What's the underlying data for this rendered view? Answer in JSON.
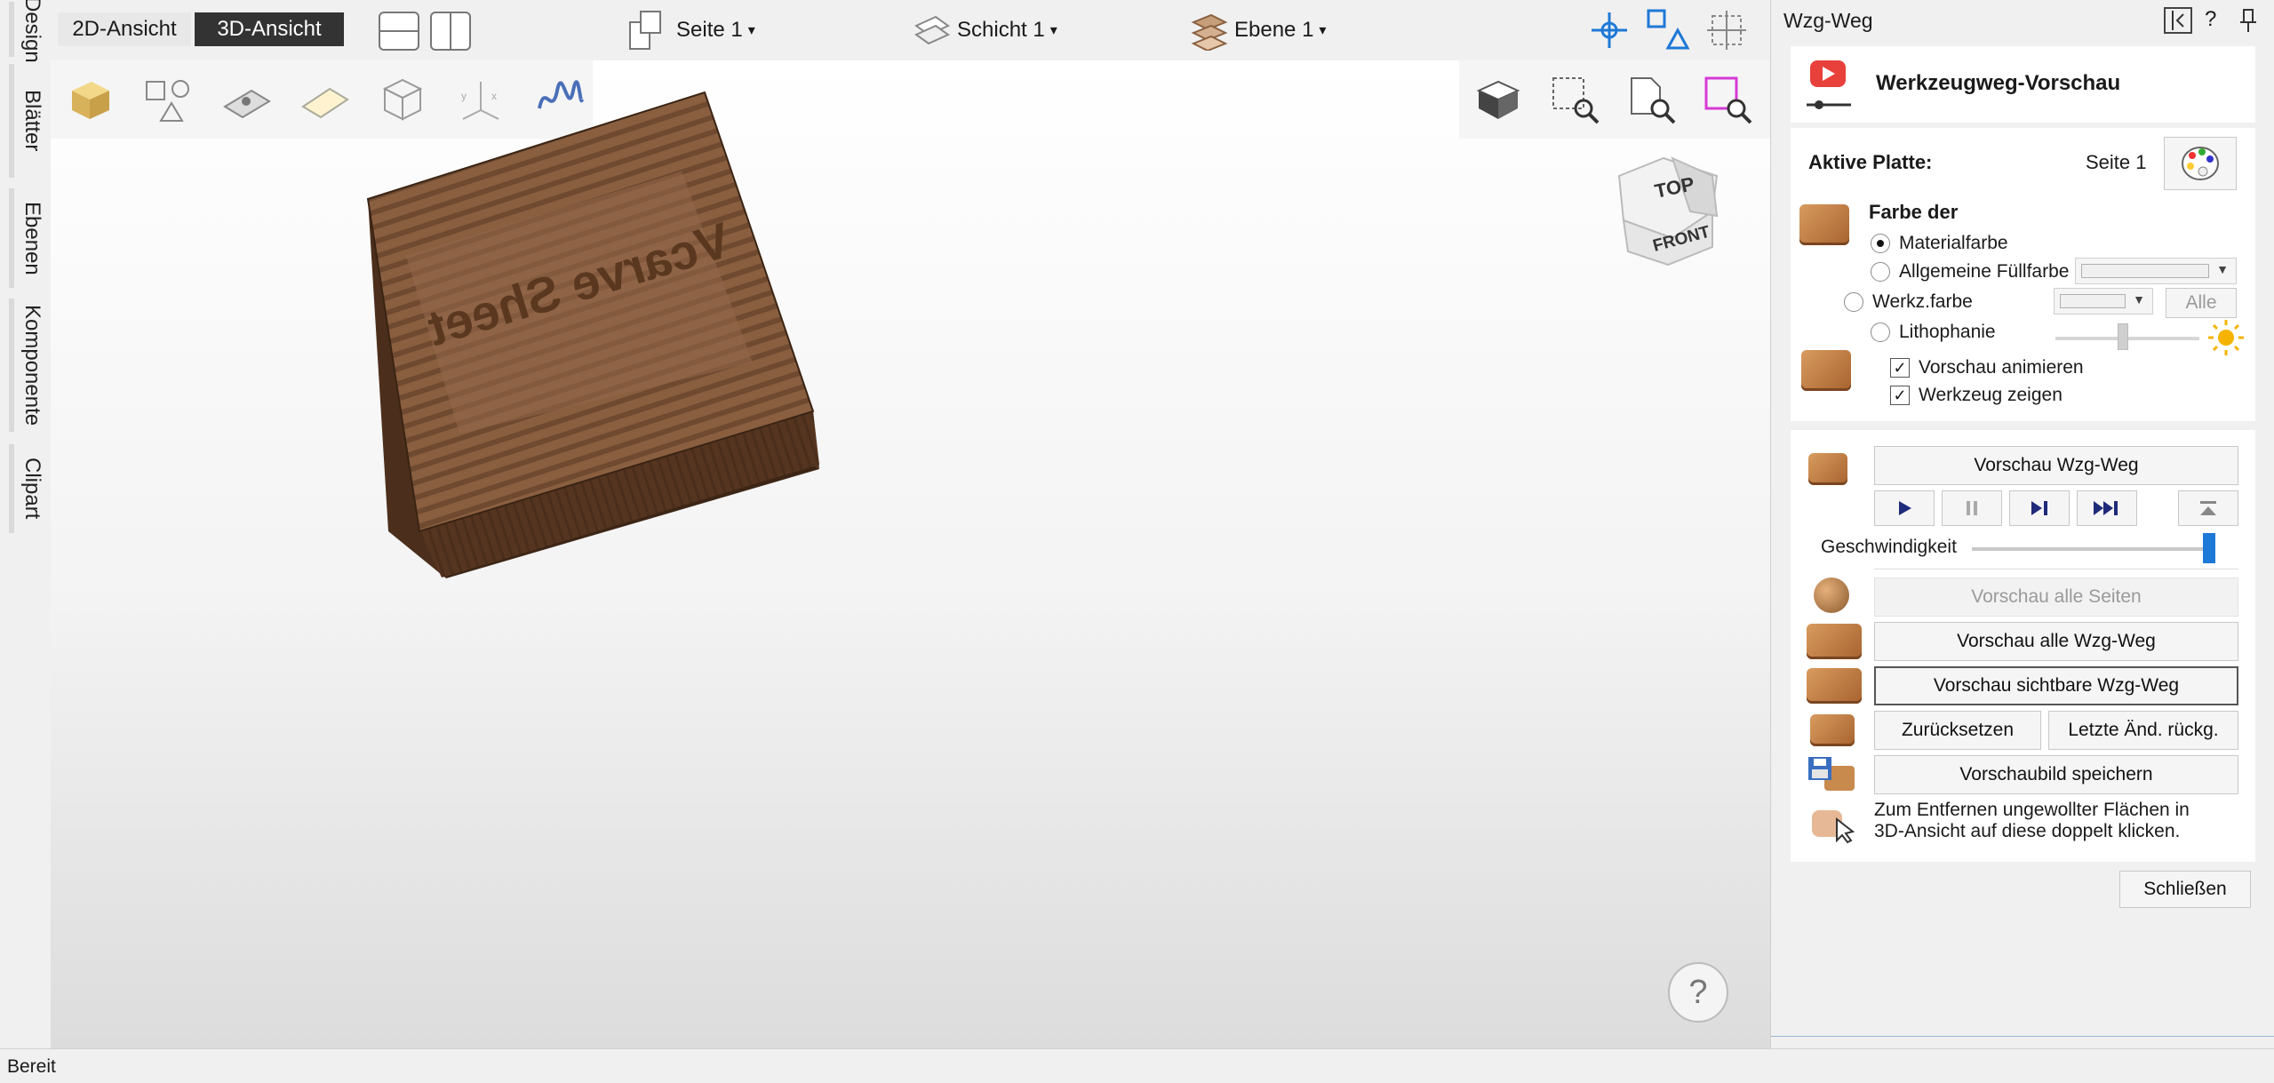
{
  "sidebar": {
    "tabs": [
      "Design",
      "Blätter",
      "Ebenen",
      "Komponente",
      "Clipart"
    ]
  },
  "toolbar": {
    "view_2d": "2D-Ansicht",
    "view_3d": "3D-Ansicht",
    "sheet": "Seite 1",
    "layer": "Schicht 1",
    "level": "Ebene 1"
  },
  "viewport": {
    "viewcube_top": "TOP",
    "viewcube_front": "FRONT",
    "engraved_text": "Vcarve Sheet",
    "help": "?"
  },
  "panel": {
    "title": "Wzg-Weg",
    "header_buttons": {
      "help": "?",
      "pin": "pin-icon",
      "collapse": "collapse-panel-icon"
    },
    "preview_title": "Werkzeugweg-Vorschau",
    "active_plate_label": "Aktive Platte:",
    "active_plate_value": "Seite 1",
    "color_of_label": "Farbe der",
    "radio_material": "Materialfarbe",
    "radio_general_fill": "Allgemeine Füllfarbe",
    "radio_tool_color": "Werkz.farbe",
    "btn_all": "Alle",
    "radio_lithophane": "Lithophanie",
    "check_animate": "Vorschau animieren",
    "check_show_tool": "Werkzeug zeigen",
    "btn_preview_toolpath": "Vorschau Wzg-Weg",
    "speed_label": "Geschwindigkeit",
    "speed_value": 1.0,
    "btn_preview_all_sheets": "Vorschau alle Seiten",
    "btn_preview_all_toolpaths": "Vorschau alle Wzg-Weg",
    "btn_preview_visible_toolpaths": "Vorschau sichtbare Wzg-Weg",
    "btn_reset": "Zurücksetzen",
    "btn_undo_last": "Letzte Änd. rückg.",
    "btn_save_preview": "Vorschaubild speichern",
    "hint_line1": "Zum Entfernen ungewollter Flächen in",
    "hint_line2": "3D-Ansicht auf diese doppelt klicken.",
    "btn_close": "Schließen"
  },
  "status": {
    "text": "Bereit"
  },
  "colors": {
    "accent": "#1e78d7",
    "dark_button": "#333333",
    "wood_top": "#8a5f40",
    "wood_side": "#5b3a22",
    "play_icon": "#1f2a7a"
  }
}
